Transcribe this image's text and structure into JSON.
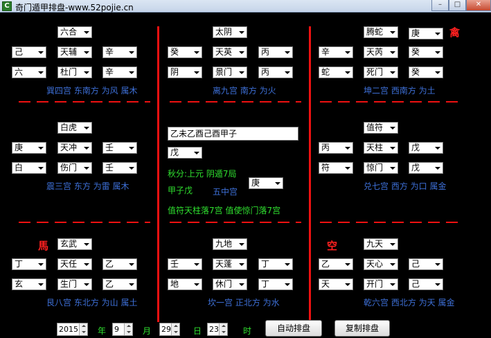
{
  "window": {
    "title": "奇门遁甲排盘-www.52pojie.cn",
    "app_icon_letter": "C",
    "min_label": "–",
    "max_label": "□",
    "close_label": "✕"
  },
  "palaces": {
    "p4": {
      "top": "六合",
      "r1": [
        "己",
        "天辅",
        "辛"
      ],
      "r2": [
        "六",
        "杜门",
        "辛"
      ],
      "info": "巽四宫 东南方 为风 属木"
    },
    "p9": {
      "top": "太阴",
      "r1": [
        "癸",
        "天英",
        "丙"
      ],
      "r2": [
        "阴",
        "景门",
        "丙"
      ],
      "info": "离九宫 南方 为火"
    },
    "p2": {
      "top": "腾蛇",
      "side": "庚",
      "mark": "禽",
      "r1": [
        "辛",
        "天芮",
        "癸"
      ],
      "r2": [
        "蛇",
        "死门",
        "癸"
      ],
      "info": "坤二宫 西南方 为土"
    },
    "p3": {
      "top": "白虎",
      "r1": [
        "庚",
        "天冲",
        "壬"
      ],
      "r2": [
        "白",
        "伤门",
        "壬"
      ],
      "info": "震三宫 东方 为雷 属木"
    },
    "p7": {
      "top": "值符",
      "r1": [
        "丙",
        "天柱",
        "戊"
      ],
      "r2": [
        "符",
        "惊门",
        "戊"
      ],
      "info": "兑七宫 西方 为口 属金"
    },
    "p8": {
      "top": "玄武",
      "mark": "馬",
      "r1": [
        "丁",
        "天任",
        "乙"
      ],
      "r2": [
        "玄",
        "生门",
        "乙"
      ],
      "info": "艮八宫 东北方 为山 属土"
    },
    "p1": {
      "top": "九地",
      "r1": [
        "壬",
        "天蓬",
        "丁"
      ],
      "r2": [
        "地",
        "休门",
        "丁"
      ],
      "info": "坎一宫 正北方 为水"
    },
    "p6": {
      "top": "九天",
      "mark": "空",
      "r1": [
        "乙",
        "天心",
        "己"
      ],
      "r2": [
        "天",
        "开门",
        "己"
      ],
      "info": "乾六宫 西北方 为天 属金"
    }
  },
  "center": {
    "ganzhi": "乙未乙酉己酉甲子",
    "gan_select": "戊",
    "season": "秋分:上元  阴遁7局",
    "xun": "甲子戊",
    "palace": "五中宫",
    "palace_select": "庚",
    "zhifu": "值符天柱落7宫  值使惊门落7宫"
  },
  "date": {
    "year": "2015",
    "year_label": "年",
    "month": "9",
    "month_label": "月",
    "day": "29",
    "day_label": "日",
    "hour": "23",
    "hour_label": "时"
  },
  "buttons": {
    "auto": "自动排盘",
    "copy": "复制排盘"
  },
  "colors": {
    "background": "#000000",
    "red": "#ee1111",
    "green": "#2fe02f",
    "blue": "#3d6fd6"
  }
}
